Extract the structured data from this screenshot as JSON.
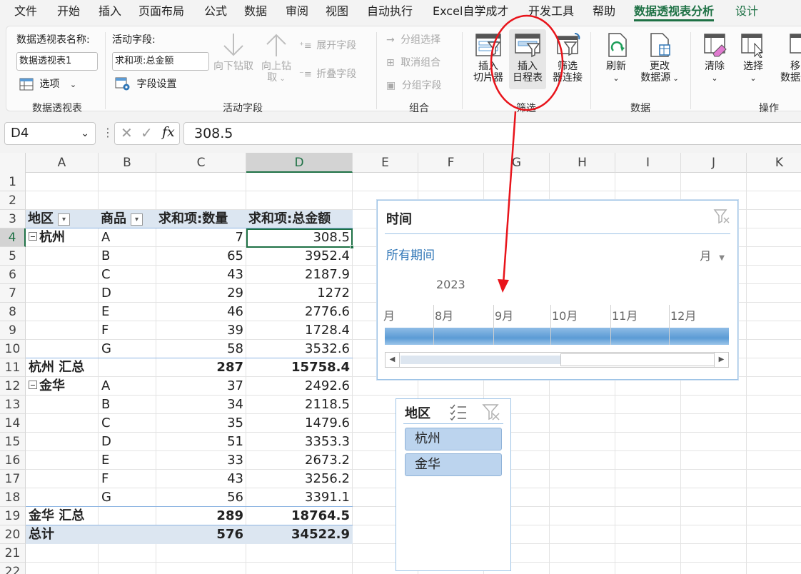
{
  "menu": {
    "tabs": [
      "文件",
      "开始",
      "插入",
      "页面布局",
      "公式",
      "数据",
      "审阅",
      "视图",
      "自动执行",
      "Excel自学成才",
      "开发工具",
      "帮助",
      "数据透视表分析",
      "设计"
    ],
    "active_tab": "数据透视表分析"
  },
  "ribbon": {
    "pivot": {
      "name_label": "数据透视表名称:",
      "name_value": "数据透视表1",
      "options_label": "选项",
      "group_label": "数据透视表"
    },
    "active_field": {
      "label": "活动字段:",
      "value": "求和项:总金额",
      "settings_label": "字段设置",
      "drill_down": "向下钻取",
      "drill_up_1": "向上钻",
      "drill_up_2": "取",
      "expand": "展开字段",
      "collapse": "折叠字段",
      "group_label": "活动字段"
    },
    "group": {
      "group_selection": "分组选择",
      "ungroup": "取消组合",
      "group_field": "分组字段",
      "group_label": "组合"
    },
    "filter": {
      "insert_slicer_1": "插入",
      "insert_slicer_2": "切片器",
      "insert_timeline_1": "插入",
      "insert_timeline_2": "日程表",
      "filter_conn_1": "筛选",
      "filter_conn_2": "器连接",
      "group_label": "筛选"
    },
    "data": {
      "refresh": "刷新",
      "change_source_1": "更改",
      "change_source_2": "数据源",
      "group_label": "数据"
    },
    "actions": {
      "clear": "清除",
      "select": "选择",
      "move_1": "移",
      "move_2": "数据透",
      "group_label": "操作"
    }
  },
  "formula_bar": {
    "name_box": "D4",
    "fx": "fx",
    "formula": "308.5"
  },
  "columns": [
    "A",
    "B",
    "C",
    "D",
    "E",
    "F",
    "G",
    "H",
    "I",
    "J",
    "K"
  ],
  "rows": [
    "1",
    "2",
    "3",
    "4",
    "5",
    "6",
    "7",
    "8",
    "9",
    "10",
    "11",
    "12",
    "13",
    "14",
    "15",
    "16",
    "17",
    "18",
    "19",
    "20",
    "21",
    "22"
  ],
  "pivot": {
    "headers": [
      "地区",
      "商品",
      "求和项:数量",
      "求和项:总金额"
    ],
    "rows": [
      {
        "region": "杭州",
        "item": "A",
        "qty": "7",
        "amount": "308.5",
        "type": "first"
      },
      {
        "region": "",
        "item": "B",
        "qty": "65",
        "amount": "3952.4",
        "type": "item"
      },
      {
        "region": "",
        "item": "C",
        "qty": "43",
        "amount": "2187.9",
        "type": "item"
      },
      {
        "region": "",
        "item": "D",
        "qty": "29",
        "amount": "1272",
        "type": "item"
      },
      {
        "region": "",
        "item": "E",
        "qty": "46",
        "amount": "2776.6",
        "type": "item"
      },
      {
        "region": "",
        "item": "F",
        "qty": "39",
        "amount": "1728.4",
        "type": "item"
      },
      {
        "region": "",
        "item": "G",
        "qty": "58",
        "amount": "3532.6",
        "type": "item"
      },
      {
        "region": "杭州 汇总",
        "item": "",
        "qty": "287",
        "amount": "15758.4",
        "type": "subtotal"
      },
      {
        "region": "金华",
        "item": "A",
        "qty": "37",
        "amount": "2492.6",
        "type": "first"
      },
      {
        "region": "",
        "item": "B",
        "qty": "34",
        "amount": "2118.5",
        "type": "item"
      },
      {
        "region": "",
        "item": "C",
        "qty": "35",
        "amount": "1479.6",
        "type": "item"
      },
      {
        "region": "",
        "item": "D",
        "qty": "51",
        "amount": "3353.3",
        "type": "item"
      },
      {
        "region": "",
        "item": "E",
        "qty": "33",
        "amount": "2673.2",
        "type": "item"
      },
      {
        "region": "",
        "item": "F",
        "qty": "43",
        "amount": "3256.2",
        "type": "item"
      },
      {
        "region": "",
        "item": "G",
        "qty": "56",
        "amount": "3391.1",
        "type": "item"
      },
      {
        "region": "金华 汇总",
        "item": "",
        "qty": "289",
        "amount": "18764.5",
        "type": "subtotal"
      },
      {
        "region": "总计",
        "item": "",
        "qty": "576",
        "amount": "34522.9",
        "type": "total"
      }
    ]
  },
  "timeline": {
    "title": "时间",
    "period_label": "所有期间",
    "level": "月",
    "year": "2023",
    "months": [
      "月",
      "8月",
      "9月",
      "10月",
      "11月",
      "12月"
    ]
  },
  "slicer": {
    "title": "地区",
    "items": [
      "杭州",
      "金华"
    ]
  },
  "colors": {
    "accent_green": "#1e7145",
    "annotation_red": "#e8141b",
    "pivot_header_fill": "#dce6f1",
    "slicer_item": "#bcd4ee"
  }
}
